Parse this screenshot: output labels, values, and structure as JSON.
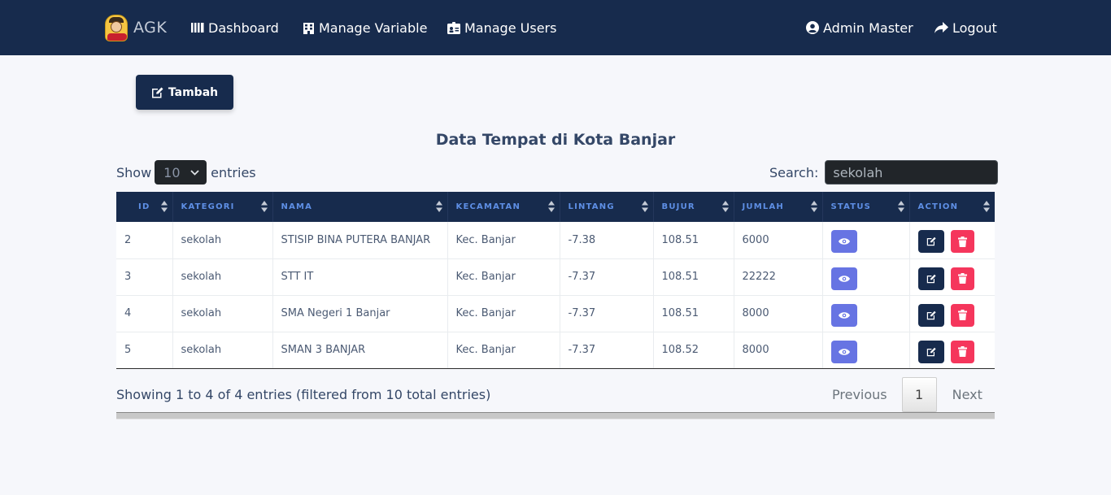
{
  "navbar": {
    "brand": "AGK",
    "items": [
      {
        "label": "Dashboard",
        "icon": "columns-icon"
      },
      {
        "label": "Manage Variable",
        "icon": "building-icon"
      },
      {
        "label": "Manage Users",
        "icon": "id-card-icon"
      }
    ],
    "user": {
      "label": "Admin Master",
      "icon": "user-circle-icon"
    },
    "logout": {
      "label": "Logout",
      "icon": "share-arrow-icon"
    }
  },
  "toolbar": {
    "add_label": "Tambah"
  },
  "page": {
    "title": "Data Tempat di Kota Banjar"
  },
  "length": {
    "show_label": "Show",
    "value": "10",
    "entries_label": "entries"
  },
  "search": {
    "label": "Search:",
    "value": "sekolah"
  },
  "table": {
    "headers": [
      "ID",
      "KATEGORI",
      "NAMA",
      "KECAMATAN",
      "LINTANG",
      "BUJUR",
      "JUMLAH",
      "STATUS",
      "ACTION"
    ],
    "rows": [
      {
        "id": "2",
        "kategori": "sekolah",
        "nama": "STISIP BINA PUTERA BANJAR",
        "kecamatan": "Kec. Banjar",
        "lintang": "-7.38",
        "bujur": "108.51",
        "jumlah": "6000"
      },
      {
        "id": "3",
        "kategori": "sekolah",
        "nama": "STT IT",
        "kecamatan": "Kec. Banjar",
        "lintang": "-7.37",
        "bujur": "108.51",
        "jumlah": "22222"
      },
      {
        "id": "4",
        "kategori": "sekolah",
        "nama": "SMA Negeri 1 Banjar",
        "kecamatan": "Kec. Banjar",
        "lintang": "-7.37",
        "bujur": "108.51",
        "jumlah": "8000"
      },
      {
        "id": "5",
        "kategori": "sekolah",
        "nama": "SMAN 3 BANJAR",
        "kecamatan": "Kec. Banjar",
        "lintang": "-7.37",
        "bujur": "108.52",
        "jumlah": "8000"
      }
    ]
  },
  "footer": {
    "info": "Showing 1 to 4 of 4 entries (filtered from 10 total entries)",
    "previous": "Previous",
    "page": "1",
    "next": "Next"
  },
  "colors": {
    "navbar": "#172b4d",
    "view_button": "#6774e3",
    "delete_button": "#f5365c",
    "header_text": "#5e8fe5"
  }
}
